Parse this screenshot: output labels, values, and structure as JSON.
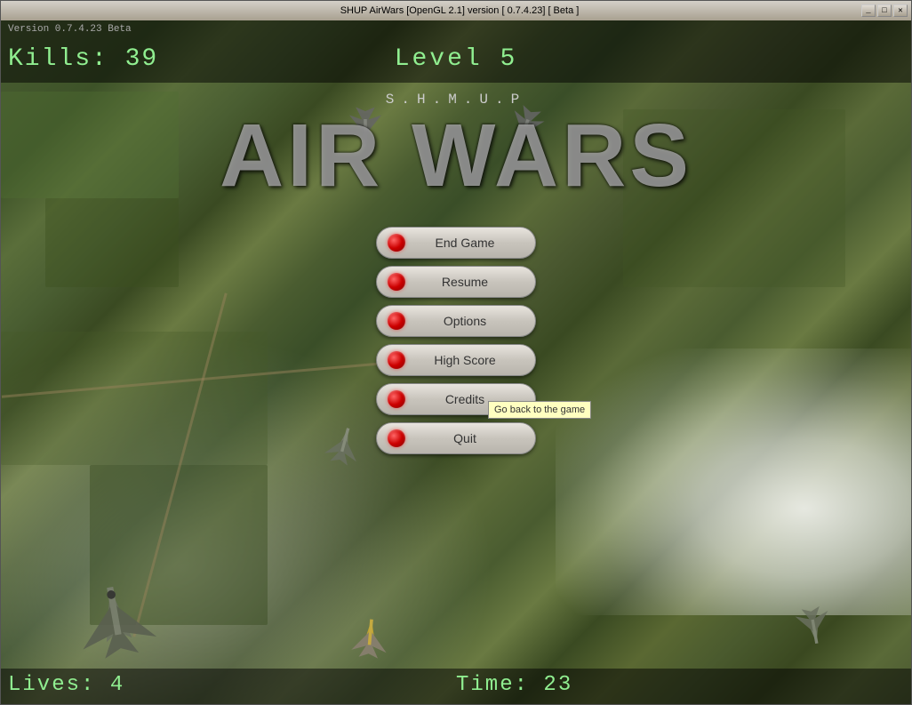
{
  "window": {
    "title": "SHUP AirWars [OpenGL 2.1] version [ 0.7.4.23] [ Beta ]",
    "controls": {
      "minimize": "_",
      "maximize": "□",
      "close": "✕"
    }
  },
  "hud": {
    "version": "Version 0.7.4.23 Beta",
    "kills_label": "Kills: 39",
    "level_label": "Level 5",
    "lives_label": "Lives: 4",
    "time_label": "Time: 23"
  },
  "title": {
    "subtitle": "S.H.M.U.P",
    "main": "AIR WARS"
  },
  "menu": {
    "buttons": [
      {
        "id": "end-game",
        "label": "End Game"
      },
      {
        "id": "resume",
        "label": "Resume"
      },
      {
        "id": "options",
        "label": "Options"
      },
      {
        "id": "high-score",
        "label": "High Score"
      },
      {
        "id": "credits",
        "label": "Credits"
      },
      {
        "id": "quit",
        "label": "Quit"
      }
    ],
    "tooltip": "Go back to the game"
  }
}
